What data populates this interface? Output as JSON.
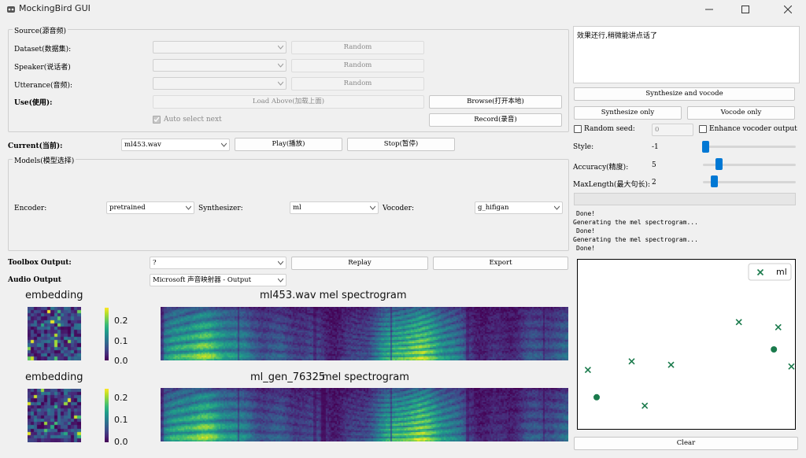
{
  "window": {
    "title": "MockingBird GUI"
  },
  "source": {
    "title": "Source(源音频)",
    "dataset_label": "Dataset(数据集):",
    "speaker_label": "Speaker(说话者)",
    "utterance_label": "Utterance(音频):",
    "random_label": "Random",
    "use_label": "Use(使用):",
    "load_above": "Load Above(加载上面)",
    "browse": "Browse(打开本地)",
    "record": "Record(录音)",
    "auto_select": "Auto select next"
  },
  "current": {
    "label": "Current(当前):",
    "value": "ml453.wav",
    "play": "Play(播放)",
    "stop": "Stop(暂停)"
  },
  "models": {
    "title": "Models(模型选择)",
    "encoder_label": "Encoder:",
    "encoder_value": "pretrained",
    "synth_label": "Synthesizer:",
    "synth_value": "ml",
    "vocoder_label": "Vocoder:",
    "vocoder_value": "g_hifigan"
  },
  "output": {
    "toolbox_label": "Toolbox Output:",
    "toolbox_value": "?",
    "replay": "Replay",
    "export": "Export",
    "audio_label": "Audio Output",
    "audio_value": "Microsoft 声音映射器 - Output"
  },
  "plots": {
    "embed1_title": "embedding",
    "embed2_title": "embedding",
    "spec1_title": "ml453.wav mel spectrogram",
    "spec2_title_a": "ml_gen_76325",
    "spec2_title_b": "mel spectrogram",
    "colorbar_ticks": [
      "0.2",
      "0.1",
      "0.0"
    ]
  },
  "right": {
    "text": "效果还行,稍微能讲点话了",
    "synth_vocode": "Synthesize and vocode",
    "synth_only": "Synthesize only",
    "vocode_only": "Vocode only",
    "random_seed_label": "Random seed:",
    "random_seed_value": "0",
    "enhance_label": "Enhance vocoder output",
    "style_label": "Style:",
    "style_value": "-1",
    "accuracy_label": "Accuracy(精度):",
    "accuracy_value": "5",
    "maxlength_label": "MaxLength(最大句长):",
    "maxlength_value": "2",
    "log_lines": [
      "Done!",
      "Generating the mel spectrogram...",
      "Done!",
      "Generating the mel spectrogram...",
      "Done!"
    ],
    "legend_label": "ml",
    "clear": "Clear"
  },
  "colors": {
    "accent": "#0078d4",
    "scatter": "#1a7a4c"
  },
  "chart_data": {
    "type": "scatter",
    "legend": "top-right",
    "series": [
      {
        "name": "ml",
        "marker": "x",
        "points": [
          [
            0.05,
            0.35
          ],
          [
            0.25,
            0.4
          ],
          [
            0.43,
            0.38
          ],
          [
            0.31,
            0.14
          ],
          [
            0.74,
            0.63
          ],
          [
            0.92,
            0.6
          ],
          [
            0.98,
            0.37
          ]
        ]
      },
      {
        "marker": "o",
        "points": [
          [
            0.09,
            0.19
          ],
          [
            0.9,
            0.47
          ]
        ]
      }
    ]
  }
}
